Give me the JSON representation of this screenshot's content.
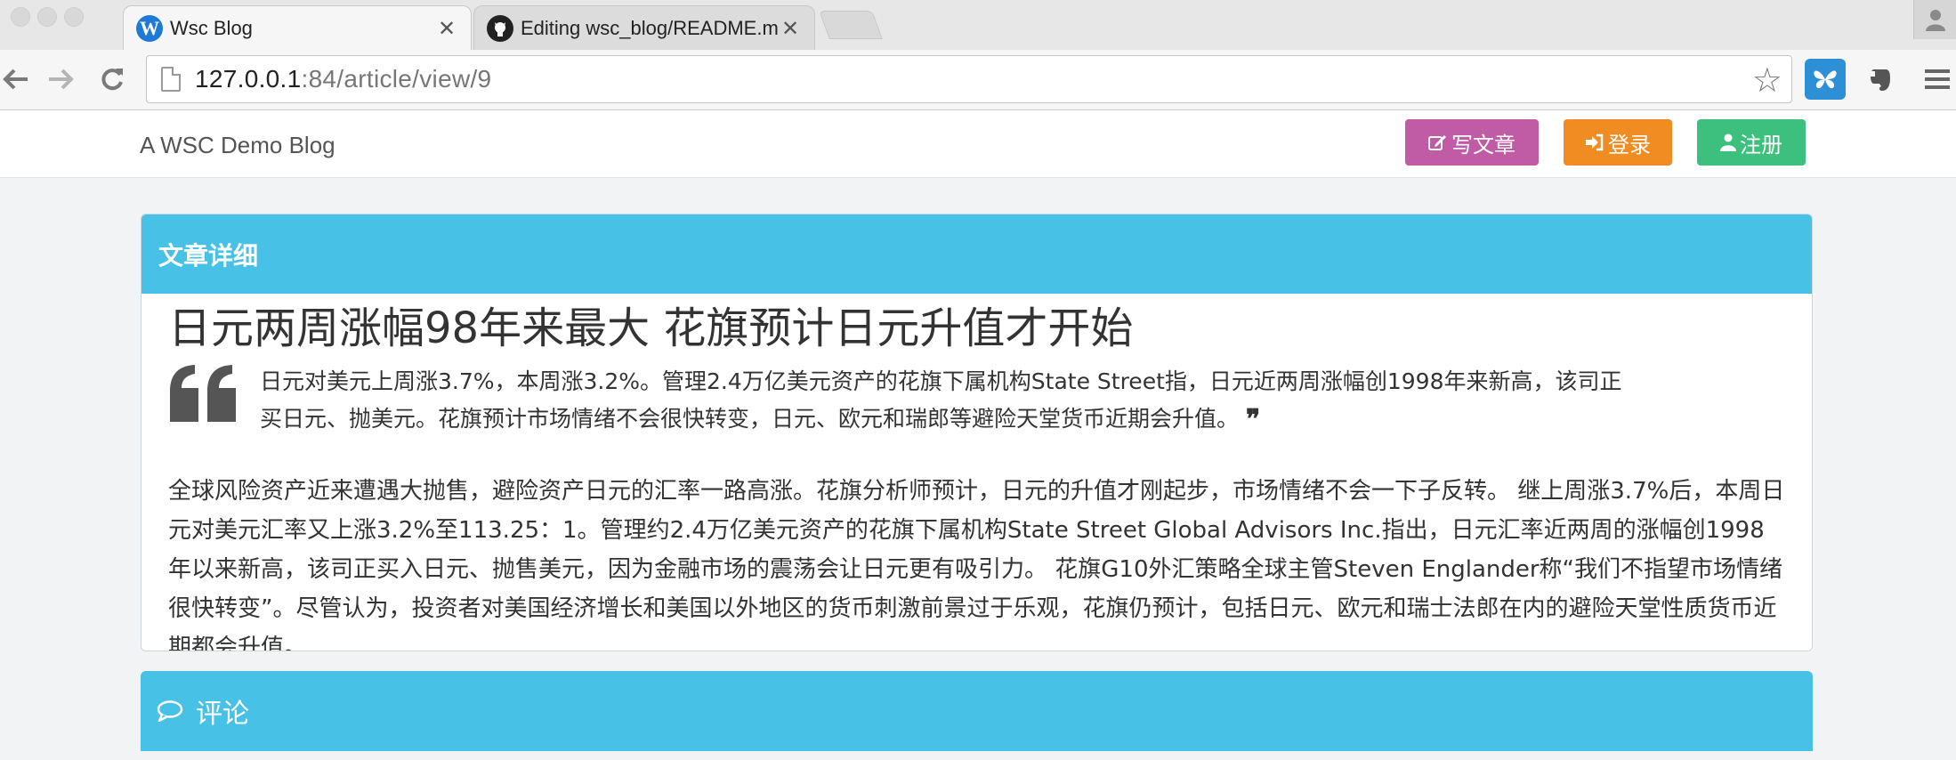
{
  "browser": {
    "tabs": [
      {
        "title": "Wsc Blog",
        "favicon": "W",
        "active": true
      },
      {
        "title": "Editing wsc_blog/README.md",
        "favicon": "github",
        "active": false
      }
    ],
    "close_glyph": "✕",
    "url": {
      "host": "127.0.0.1",
      "rest": ":84/article/view/9"
    }
  },
  "navbar": {
    "brand": "A WSC Demo Blog",
    "buttons": {
      "write": "写文章",
      "login": "登录",
      "register": "注册"
    },
    "colors": {
      "write": "#bf5ca5",
      "login": "#f08d22",
      "register": "#3dbf7e"
    }
  },
  "article_panel": {
    "heading": "文章详细",
    "title": "日元两周涨幅98年来最大 花旗预计日元升值才开始",
    "summary": "日元对美元上周涨3.7%，本周涨3.2%。管理2.4万亿美元资产的花旗下属机构State Street指，日元近两周涨幅创1998年来新高，该司正买日元、抛美元。花旗预计市场情绪不会很快转变，日元、欧元和瑞郎等避险天堂货币近期会升值。",
    "body": "全球风险资产近来遭遇大抛售，避险资产日元的汇率一路高涨。花旗分析师预计，日元的升值才刚起步，市场情绪不会一下子反转。 继上周涨3.7%后，本周日元对美元汇率又上涨3.2%至113.25：1。管理约2.4万亿美元资产的花旗下属机构State Street Global Advisors Inc.指出，日元汇率近两周的涨幅创1998年以来新高，该司正买入日元、抛售美元，因为金融市场的震荡会让日元更有吸引力。 花旗G10外汇策略全球主管Steven Englander称“我们不指望市场情绪很快转变”。尽管认为，投资者对美国经济增长和美国以外地区的货币刺激前景过于乐观，花旗仍预计，包括日元、欧元和瑞士法郎在内的避险天堂性质货币近期都会升值。"
  },
  "comments_panel": {
    "heading": "评论"
  },
  "theme": {
    "panel_header": "#47c1e6"
  }
}
